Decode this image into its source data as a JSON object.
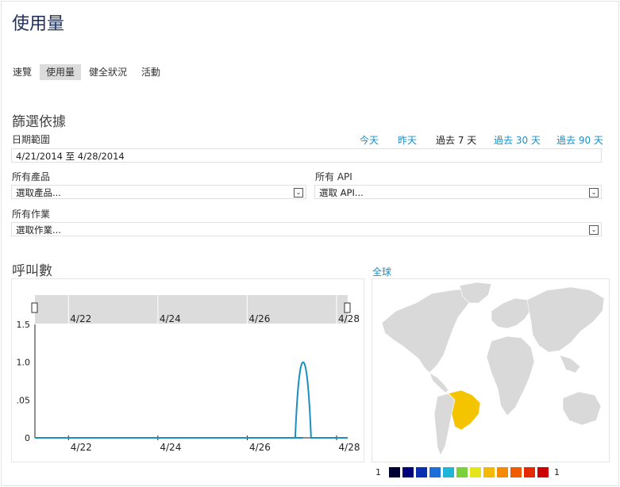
{
  "page_title": "使用量",
  "tabs": [
    {
      "label": "速覽",
      "active": false
    },
    {
      "label": "使用量",
      "active": true
    },
    {
      "label": "健全狀況",
      "active": false
    },
    {
      "label": "活動",
      "active": false
    }
  ],
  "filter": {
    "heading": "篩選依據",
    "date_range_label": "日期範圍",
    "quick_ranges": [
      {
        "label": "今天",
        "selected": false
      },
      {
        "label": "昨天",
        "selected": false
      },
      {
        "label": "過去 7 天",
        "selected": true
      },
      {
        "label": "過去 30 天",
        "selected": false
      },
      {
        "label": "過去 90 天",
        "selected": false
      }
    ],
    "date_range_value": "4/21/2014 至 4/28/2014",
    "products_label": "所有產品",
    "products_value": "選取產品...",
    "api_label": "所有 API",
    "api_value": "選取 API...",
    "operations_label": "所有作業",
    "operations_value": "選取作業..."
  },
  "calls": {
    "heading": "呼叫數",
    "globe_link": "全球"
  },
  "chart_data": {
    "type": "line",
    "title": "",
    "xlabel": "",
    "ylabel": "",
    "y_ticks": [
      "1.5",
      "1.0",
      ".05",
      "0"
    ],
    "x_ticks": [
      "4/22",
      "4/24",
      "4/26",
      "4/28"
    ],
    "navigator_ticks": [
      "4/22",
      "4/24",
      "4/26",
      "4/28"
    ],
    "ylim": [
      0,
      1.5
    ],
    "x": [
      "4/21",
      "4/22",
      "4/23",
      "4/24",
      "4/25",
      "4/26",
      "4/27",
      "4/27 12:00",
      "4/28"
    ],
    "series": [
      {
        "values": [
          0,
          0,
          0,
          0,
          0,
          0,
          0,
          1.0,
          0
        ]
      }
    ],
    "line_color": "#1b8fbf"
  },
  "map": {
    "highlight_color": "#f5c400",
    "base_color": "#d9d9d9"
  },
  "scale": {
    "min_label": "1",
    "max_label": "1",
    "colors": [
      "#000033",
      "#00007a",
      "#0a2fb0",
      "#1e6fd9",
      "#1fb5d9",
      "#7ad13b",
      "#e5e51a",
      "#f5b800",
      "#f58a00",
      "#f05a00",
      "#e62a00",
      "#cc0000"
    ]
  }
}
